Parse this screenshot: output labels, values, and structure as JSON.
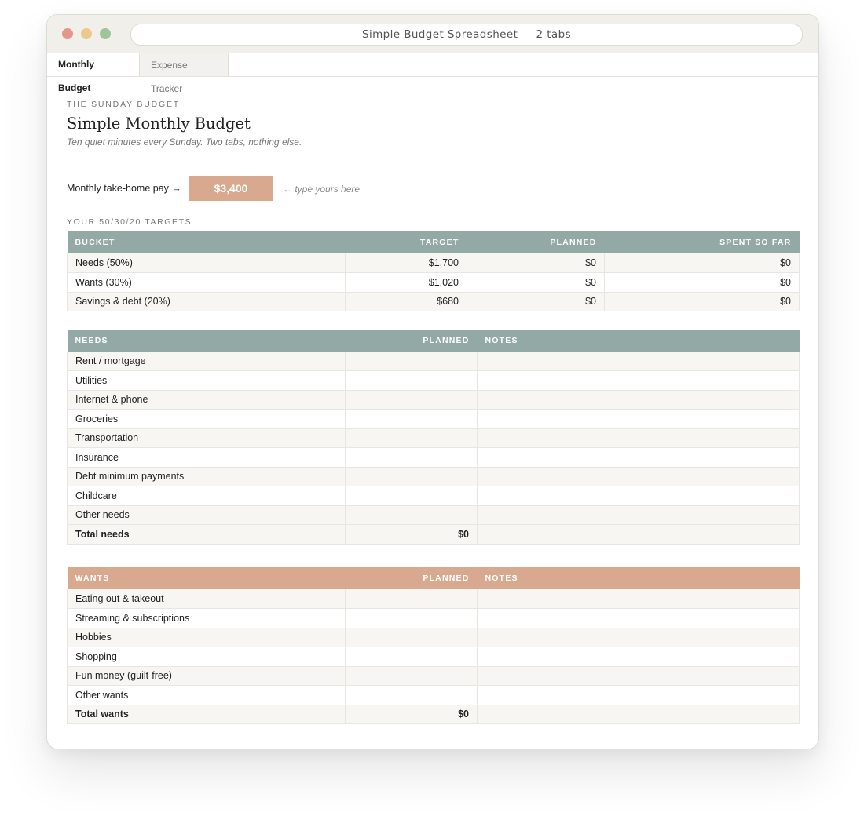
{
  "window": {
    "title": "Simple Budget Spreadsheet — 2 tabs"
  },
  "tabs": [
    {
      "label": "Monthly Budget",
      "active": true
    },
    {
      "label": "Expense Tracker",
      "active": false
    }
  ],
  "sheet": {
    "eyebrow": "THE SUNDAY BUDGET",
    "title": "Simple Monthly Budget",
    "subtitle": "Ten quiet minutes every Sunday. Two tabs, nothing else.",
    "pay": {
      "label": "Monthly take-home pay →",
      "value": "$3,400",
      "hint": "← type yours here"
    },
    "targets_label": "YOUR 50/30/20 TARGETS"
  },
  "colors": {
    "sage": "#93a9a6",
    "peach": "#d8a98e"
  },
  "targets": {
    "headers": [
      "BUCKET",
      "TARGET",
      "PLANNED",
      "SPENT SO FAR"
    ],
    "rows": [
      [
        "Needs (50%)",
        "$1,700",
        "$0",
        "$0"
      ],
      [
        "Wants (30%)",
        "$1,020",
        "$0",
        "$0"
      ],
      [
        "Savings & debt (20%)",
        "$680",
        "$0",
        "$0"
      ]
    ]
  },
  "needs": {
    "headers": [
      "NEEDS",
      "PLANNED",
      "NOTES"
    ],
    "rows": [
      "Rent / mortgage",
      "Utilities",
      "Internet & phone",
      "Groceries",
      "Transportation",
      "Insurance",
      "Debt minimum payments",
      "Childcare",
      "Other needs"
    ],
    "total_label": "Total needs",
    "total_value": "$0"
  },
  "wants": {
    "headers": [
      "WANTS",
      "PLANNED",
      "NOTES"
    ],
    "rows": [
      "Eating out & takeout",
      "Streaming & subscriptions",
      "Hobbies",
      "Shopping",
      "Fun money (guilt-free)",
      "Other wants"
    ],
    "total_label": "Total wants",
    "total_value": "$0"
  }
}
